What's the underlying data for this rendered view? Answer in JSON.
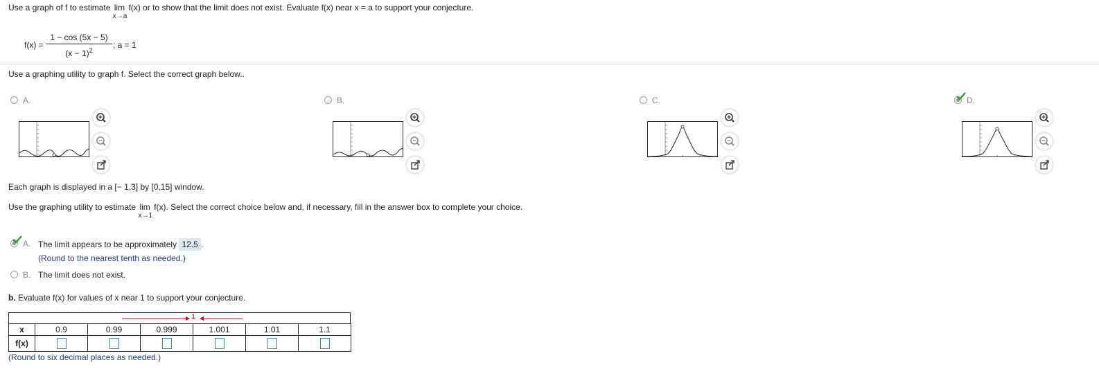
{
  "question": {
    "part1": "Use a graph of f to estimate",
    "lim": "lim",
    "limsub": "x→a",
    "part2": "f(x) or to show that the limit does not exist. Evaluate f(x) near x = a to support your conjecture."
  },
  "function": {
    "lhs": "f(x) =",
    "numerator": "1 − cos (5x − 5)",
    "denominator_base": "(x − 1)",
    "denominator_exp": "2",
    "a_label": "; a = 1"
  },
  "part_a": {
    "prompt": "Use a graphing utility to graph f. Select the correct graph below..",
    "options": [
      {
        "letter": "A."
      },
      {
        "letter": "B."
      },
      {
        "letter": "C."
      },
      {
        "letter": "D."
      }
    ],
    "window_note": "Each graph is displayed in a [− 1,3] by [0,15] window."
  },
  "estimate": {
    "prompt_pre": "Use the graphing utility to estimate",
    "lim": "lim",
    "limsub": "x→1",
    "prompt_post": "f(x). Select the correct choice below and, if necessary, fill in the answer box to complete your choice.",
    "choice_a_letter": "A.",
    "choice_a_text": "The limit appears to be approximately",
    "choice_a_value": "12.5",
    "choice_a_period": ".",
    "choice_a_hint": "(Round to the nearest tenth as needed.)",
    "choice_b_letter": "B.",
    "choice_b_text": "The limit does not exist."
  },
  "part_b": {
    "prompt_bold": "b.",
    "prompt": "Evaluate f(x) for values of x near 1 to support your conjecture.",
    "arrow_label": "1",
    "row_x_label": "x",
    "row_fx_label": "f(x)",
    "x_values": [
      "0.9",
      "0.99",
      "0.999",
      "1.001",
      "1.01",
      "1.1"
    ],
    "hint": "(Round to six decimal places as needed.)"
  },
  "colors": {
    "check": "#2e9e2e",
    "hint_blue": "#1f3b8f",
    "arrow_red": "#d0021b",
    "input_border": "#2e8fb3",
    "answer_bg": "#dde6f3"
  }
}
